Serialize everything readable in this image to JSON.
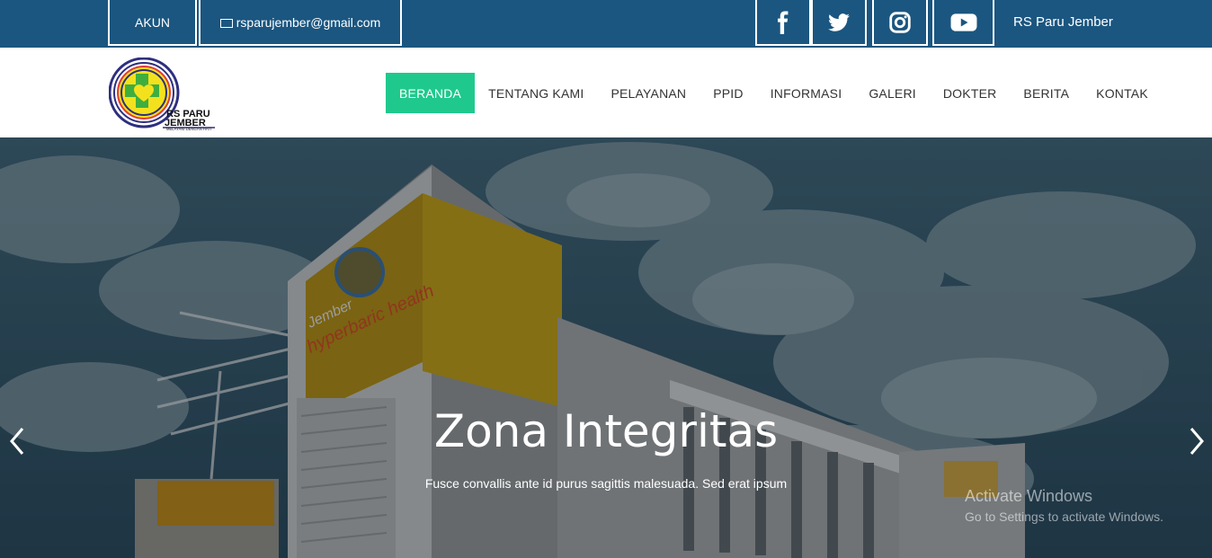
{
  "topbar": {
    "account_label": "AKUN",
    "email": "rsparujember@gmail.com",
    "social": [
      "facebook-icon",
      "twitter-icon",
      "instagram-icon",
      "youtube-icon"
    ],
    "site_name": "RS Paru Jember"
  },
  "logo": {
    "line1": "RS PARU",
    "line2": "JEMBER",
    "tagline": "MELAYANI DENGAN HATI"
  },
  "nav": {
    "items": [
      "BERANDA",
      "TENTANG KAMI",
      "PELAYANAN",
      "PPID",
      "INFORMASI",
      "GALERI",
      "DOKTER",
      "BERITA",
      "KONTAK"
    ],
    "active_index": 0
  },
  "hero": {
    "title": "Zona Integritas",
    "subtitle": "Fusce convallis ante id purus sagittis malesuada. Sed erat ipsum",
    "prev_icon": "chevron-left-icon",
    "next_icon": "chevron-right-icon",
    "building_sign_top": "Jember",
    "building_sign_bottom": "hyperbaric health"
  },
  "watermark": {
    "title": "Activate Windows",
    "subtitle": "Go to Settings to activate Windows."
  },
  "colors": {
    "topbar": "#1b5680",
    "active_nav": "#1fc98d",
    "nav_text": "#333333"
  }
}
